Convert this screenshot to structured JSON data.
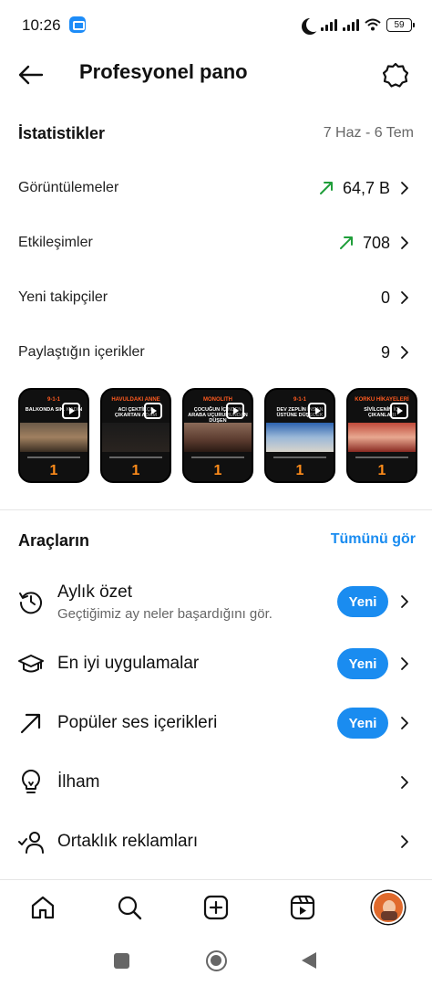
{
  "status_bar": {
    "time": "10:26",
    "battery": "59"
  },
  "header": {
    "title": "Profesyonel pano"
  },
  "stats": {
    "title": "İstatistikler",
    "date_range": "7 Haz - 6 Tem",
    "rows": [
      {
        "label": "Görüntülemeler",
        "value": "64,7 B",
        "trend": "up"
      },
      {
        "label": "Etkileşimler",
        "value": "708",
        "trend": "up"
      },
      {
        "label": "Yeni takipçiler",
        "value": "0",
        "trend": ""
      },
      {
        "label": "Paylaştığın içerikler",
        "value": "9",
        "trend": ""
      }
    ]
  },
  "thumbnails": [
    {
      "caption_top": "9-1-1",
      "caption": "BALKONDA SIK. KADIN",
      "number": "1"
    },
    {
      "caption_top": "HAVULDAKI ANNE",
      "caption": "ACI ÇEKTİKÇE ÇIKARTAN ADAM",
      "number": "1"
    },
    {
      "caption_top": "MONOLITH",
      "caption": "ÇOCUĞUN İÇİNDEN ARABA UÇURUMUNDAN DÜŞEN",
      "number": "1"
    },
    {
      "caption_top": "9-1-1",
      "caption": "DEV ZEPLİN İNSAN ÜSTÜNE DÜŞECEK",
      "number": "1"
    },
    {
      "caption_top": "KORKU HİKAYELERİ",
      "caption": "SİVİLCENİN İÇİ ÇIKANLARI",
      "number": "1"
    }
  ],
  "tools": {
    "title": "Araçların",
    "see_all": "Tümünü gör",
    "items": [
      {
        "label": "Aylık özet",
        "subtitle": "Geçtiğimiz ay neler başardığını gör.",
        "badge": "Yeni",
        "icon": "history-icon"
      },
      {
        "label": "En iyi uygulamalar",
        "subtitle": "",
        "badge": "Yeni",
        "icon": "graduation-cap-icon"
      },
      {
        "label": "Popüler ses içerikleri",
        "subtitle": "",
        "badge": "Yeni",
        "icon": "arrow-up-right-icon"
      },
      {
        "label": "İlham",
        "subtitle": "",
        "badge": "",
        "icon": "lightbulb-icon"
      },
      {
        "label": "Ortaklık reklamları",
        "subtitle": "",
        "badge": "",
        "icon": "partner-check-icon"
      }
    ]
  },
  "colors": {
    "accent": "#1a8cf0",
    "trend_up": "#1f9e3a",
    "muted": "#666666"
  }
}
